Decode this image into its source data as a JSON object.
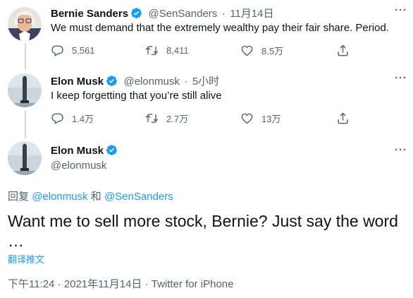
{
  "tweets": [
    {
      "name": "Bernie Sanders",
      "handle": "@SenSanders",
      "sep": "·",
      "time": "11月14日",
      "text": "We must demand that the extremely wealthy pay their fair share. Period.",
      "replies": "5,561",
      "retweets": "8,411",
      "likes": "8.5万"
    },
    {
      "name": "Elon Musk",
      "handle": "@elonmusk",
      "sep": "·",
      "time": "5小时",
      "text": "I keep forgetting that you’re still alive",
      "replies": "1.4万",
      "retweets": "2.7万",
      "likes": "13万"
    }
  ],
  "main": {
    "name": "Elon Musk",
    "handle": "@elonmusk",
    "reply_prefix": "回复",
    "reply_to_1": "@elonmusk",
    "reply_and": "和",
    "reply_to_2": "@SenSanders",
    "text_line1": "Want me to sell more stock, Bernie? Just say the word",
    "text_line2": "…",
    "translate": "翻译推文",
    "time": "下午11:24",
    "dot1": "·",
    "date": "2021年11月14日",
    "dot2": "·",
    "source": "Twitter for iPhone"
  },
  "more_label": "···",
  "colors": {
    "accent": "#1d9bf0",
    "muted": "#536471",
    "text": "#0f1419",
    "line": "#cfd9de"
  }
}
